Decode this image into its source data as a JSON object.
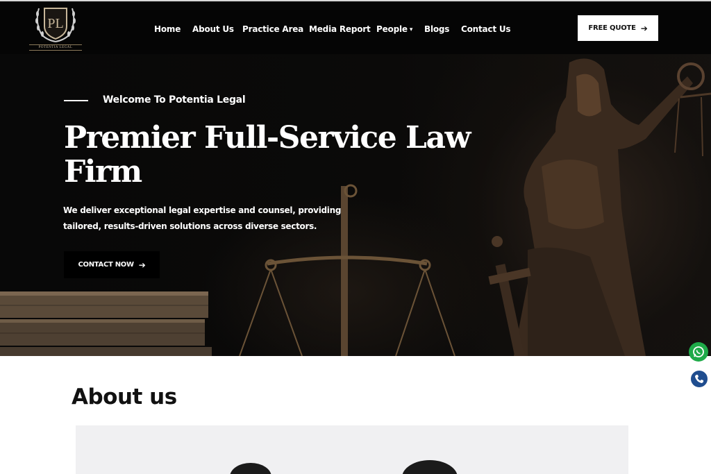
{
  "header": {
    "logo": {
      "monogram": "PL",
      "wordmark": "POTENTIA LEGAL"
    },
    "nav": [
      {
        "label": "Home"
      },
      {
        "label": "About Us"
      },
      {
        "label": "Practice Area"
      },
      {
        "label": "Media Report"
      },
      {
        "label": "People",
        "has_dropdown": true
      },
      {
        "label": "Blogs"
      },
      {
        "label": "Contact Us"
      }
    ],
    "quote_button": {
      "label": "FREE QUOTE",
      "icon": "arrow-right-icon"
    }
  },
  "hero": {
    "welcome": "Welcome To Potentia Legal",
    "headline": "Premier Full-Service Law Firm",
    "subtext": "We deliver exceptional legal expertise and counsel, providing tailored, results-driven solutions across diverse sectors.",
    "cta": {
      "label": "CONTACT NOW",
      "icon": "arrow-right-icon"
    },
    "background_imagery": [
      "lady-justice-statue",
      "scales-of-justice",
      "stacked-books"
    ]
  },
  "floating": [
    {
      "name": "whatsapp-icon",
      "color": "#1faa49"
    },
    {
      "name": "phone-icon",
      "color": "#1f4d8f"
    }
  ],
  "about": {
    "title": "About us"
  },
  "colors": {
    "header_bg": "#050505",
    "hero_bg": "#070707",
    "accent_gold": "#c8b79a",
    "text_light": "#ffffff",
    "text_dark": "#111111"
  }
}
